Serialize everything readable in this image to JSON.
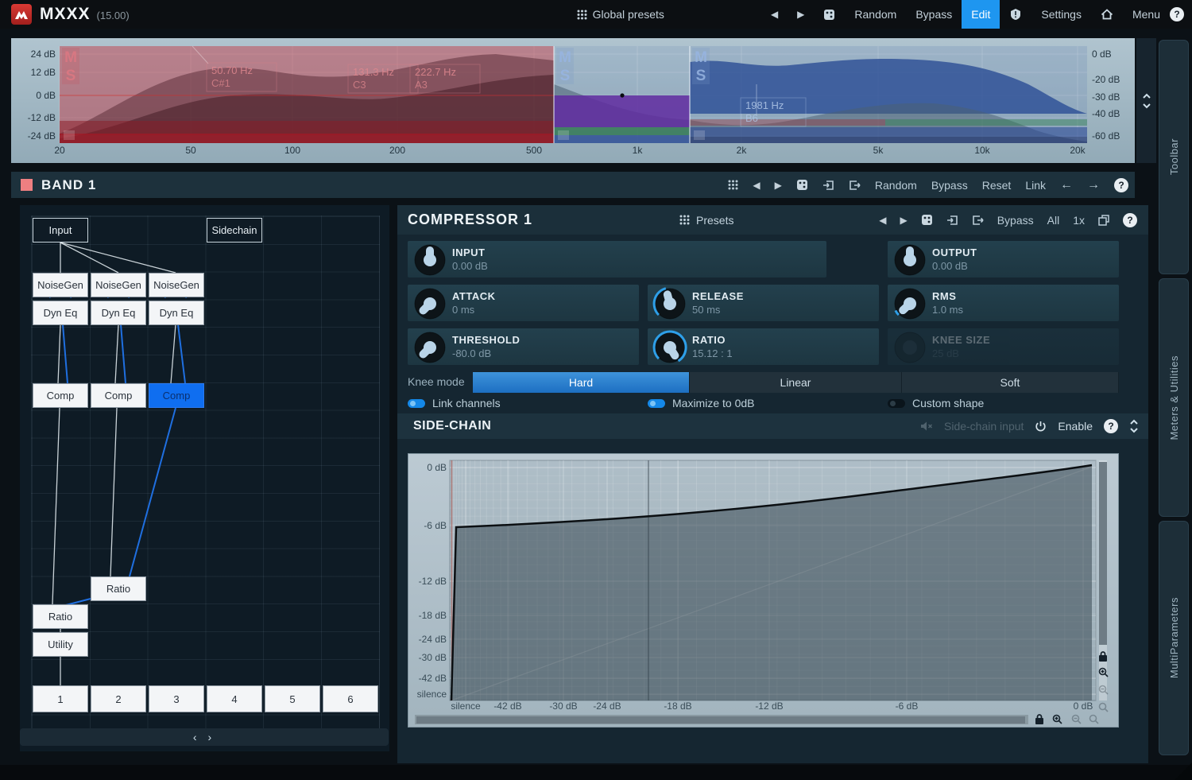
{
  "top_bar": {
    "logo": "MXXX",
    "version": "(15.00)",
    "global_presets": "Global presets",
    "random": "Random",
    "bypass": "Bypass",
    "edit": "Edit",
    "settings": "Settings",
    "menu": "Menu",
    "help": "?"
  },
  "spectrum": {
    "left_db_labels": [
      "24 dB",
      "12 dB",
      "0 dB",
      "-12 dB",
      "-24 dB"
    ],
    "right_db_labels": [
      "0 dB",
      "-20 dB",
      "-30 dB",
      "-40 dB",
      "-60 dB"
    ],
    "freq_labels": [
      "20",
      "50",
      "100",
      "200",
      "500",
      "1k",
      "2k",
      "5k",
      "10k",
      "20k"
    ],
    "ms_letters": [
      "M",
      "S"
    ],
    "markers": [
      {
        "freq": "50.70 Hz",
        "note": "C#1"
      },
      {
        "freq": "131.3 Hz",
        "note": "C3"
      },
      {
        "freq": "222.7 Hz",
        "note": "A3"
      },
      {
        "freq": "1981 Hz",
        "note": "B6"
      }
    ]
  },
  "band": {
    "title": "BAND 1",
    "random": "Random",
    "bypass": "Bypass",
    "reset": "Reset",
    "link": "Link"
  },
  "matrix": {
    "nodes": [
      {
        "label": "Input"
      },
      {
        "label": "Sidechain"
      },
      {
        "label": "NoiseGen"
      },
      {
        "label": "NoiseGen"
      },
      {
        "label": "NoiseGen"
      },
      {
        "label": "Dyn Eq"
      },
      {
        "label": "Dyn Eq"
      },
      {
        "label": "Dyn Eq"
      },
      {
        "label": "Comp"
      },
      {
        "label": "Comp"
      },
      {
        "label": "Comp"
      },
      {
        "label": "Ratio"
      },
      {
        "label": "Ratio"
      },
      {
        "label": "Utility"
      }
    ],
    "slots": [
      "1",
      "2",
      "3",
      "4",
      "5",
      "6"
    ],
    "scroll_hint": "‹ ›"
  },
  "compressor": {
    "title": "COMPRESSOR 1",
    "presets": "Presets",
    "bypass": "Bypass",
    "all": "All",
    "one_x": "1x",
    "knobs": [
      {
        "label": "INPUT",
        "value": "0.00 dB"
      },
      {
        "label": "OUTPUT",
        "value": "0.00 dB"
      },
      {
        "label": "ATTACK",
        "value": "0 ms"
      },
      {
        "label": "RELEASE",
        "value": "50 ms"
      },
      {
        "label": "RMS",
        "value": "1.0 ms"
      },
      {
        "label": "THRESHOLD",
        "value": "-80.0 dB"
      },
      {
        "label": "RATIO",
        "value": "15.12 : 1"
      },
      {
        "label": "KNEE SIZE",
        "value": "25 dB"
      }
    ],
    "knee": {
      "label": "Knee mode",
      "options": [
        "Hard",
        "Linear",
        "Soft"
      ],
      "selected": "Hard"
    },
    "toggles": [
      {
        "label": "Link channels",
        "on": true
      },
      {
        "label": "Maximize to 0dB",
        "on": true
      },
      {
        "label": "Custom shape",
        "on": false
      }
    ]
  },
  "sidechain": {
    "title": "SIDE-CHAIN",
    "input_label": "Side-chain input",
    "enable": "Enable",
    "graph": {
      "y_labels": [
        "0 dB",
        "-6 dB",
        "-12 dB",
        "-18 dB",
        "-24 dB",
        "-30 dB",
        "-42 dB",
        "silence"
      ],
      "x_labels": [
        "silence",
        "-42 dB",
        "-30 dB",
        "-24 dB",
        "-18 dB",
        "-12 dB",
        "-6 dB",
        "0 dB"
      ],
      "curve_points_db": [
        {
          "in": "silence",
          "out": "silence"
        },
        {
          "in": -80,
          "out": -5.5
        },
        {
          "in": 0,
          "out": -0.5
        }
      ]
    }
  },
  "sidebar": {
    "tabs": [
      "Toolbar",
      "Meters & Utilities",
      "MultiParameters"
    ]
  }
}
